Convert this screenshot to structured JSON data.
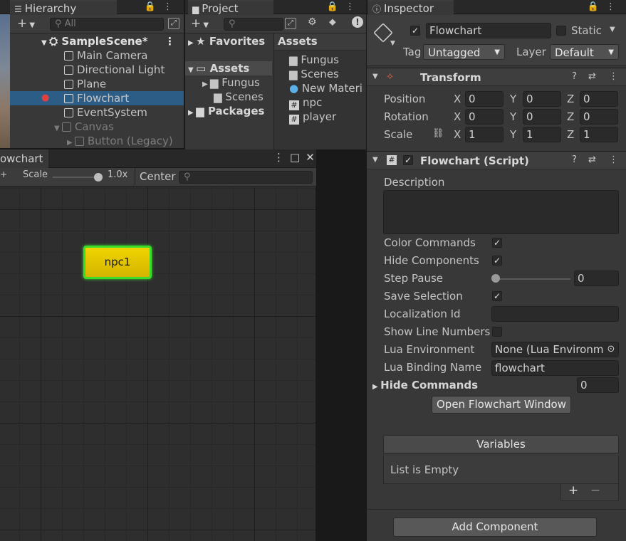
{
  "hierarchy": {
    "tab_label": "Hierarchy",
    "search_placeholder": "All",
    "scene": "SampleScene*",
    "items": [
      {
        "label": "Main Camera"
      },
      {
        "label": "Directional Light"
      },
      {
        "label": "Plane"
      },
      {
        "label": "Flowchart"
      },
      {
        "label": "EventSystem"
      },
      {
        "label": "Canvas"
      },
      {
        "label": "Button (Legacy)"
      }
    ]
  },
  "project": {
    "tab_label": "Project",
    "favorites": "Favorites",
    "assets_tree": "Assets",
    "fungus": "Fungus",
    "scenes": "Scenes",
    "packages": "Packages",
    "assets_header": "Assets",
    "files": [
      {
        "label": "Fungus"
      },
      {
        "label": "Scenes"
      },
      {
        "label": "New Materi"
      },
      {
        "label": "npc"
      },
      {
        "label": "player"
      }
    ]
  },
  "flowchart_window": {
    "tab_label": "owchart",
    "scale_label": "Scale",
    "scale_value": "1.0x",
    "center_label": "Center",
    "block_label": "npc1"
  },
  "inspector": {
    "tab_label": "Inspector",
    "object_name": "Flowchart",
    "static_label": "Static",
    "tag_label": "Tag",
    "tag_value": "Untagged",
    "layer_label": "Layer",
    "layer_value": "Default",
    "transform": {
      "title": "Transform",
      "position_label": "Position",
      "rotation_label": "Rotation",
      "scale_label": "Scale",
      "x": "X",
      "y": "Y",
      "z": "Z",
      "position": [
        "0",
        "0",
        "0"
      ],
      "rotation": [
        "0",
        "0",
        "0"
      ],
      "scale": [
        "1",
        "1",
        "1"
      ]
    },
    "script": {
      "title": "Flowchart (Script)",
      "description_label": "Description",
      "color_commands": "Color Commands",
      "hide_components": "Hide Components",
      "step_pause": "Step Pause",
      "step_pause_value": "0",
      "save_selection": "Save Selection",
      "localization_id": "Localization Id",
      "show_line_numbers": "Show Line Numbers",
      "lua_environment": "Lua Environment",
      "lua_environment_value": "None (Lua Environm",
      "lua_binding_name": "Lua Binding Name",
      "lua_binding_value": "flowchart",
      "hide_commands": "Hide Commands",
      "hide_commands_value": "0",
      "open_button": "Open Flowchart Window",
      "variables_label": "Variables",
      "list_empty": "List is Empty",
      "add_sym": "+",
      "remove_sym": "−"
    },
    "add_component": "Add Component"
  },
  "colors": {
    "accent": "#2c5d87",
    "block_fill": "#e8c800",
    "block_border": "#3bdc2a"
  }
}
